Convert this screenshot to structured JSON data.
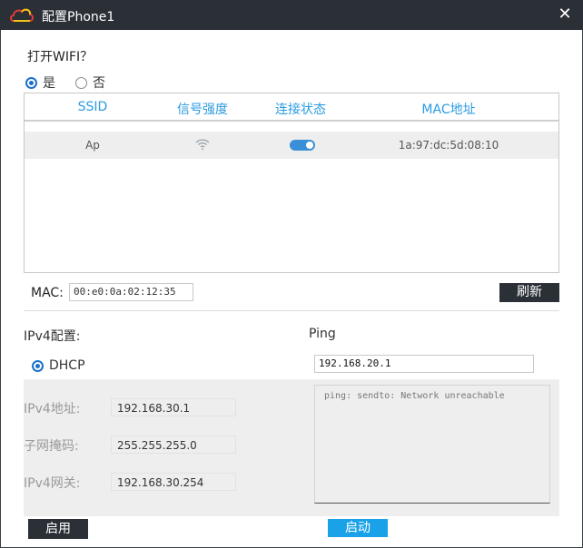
{
  "window": {
    "title": "配置Phone1",
    "close_glyph": "✕"
  },
  "wifi": {
    "question": "打开WIFI？",
    "options": [
      {
        "label": "是",
        "selected": true
      },
      {
        "label": "否",
        "selected": false
      }
    ],
    "table": {
      "headers": [
        "SSID",
        "信号强度",
        "连接状态",
        "MAC地址"
      ],
      "rows": [
        {
          "ssid": "Ap",
          "signal_icon": "wifi-signal-icon",
          "status_icon": "toggle-on-icon",
          "mac": "1a:97:dc:5d:08:10"
        }
      ]
    }
  },
  "mac": {
    "label": "MAC:",
    "value": "00:e0:0a:02:12:35",
    "refresh_label": "刷新"
  },
  "ipv4": {
    "title": "IPv4配置:",
    "mode_label": "DHCP",
    "fields": [
      {
        "label": "IPv4地址:",
        "value": "192.168.30.1"
      },
      {
        "label": "子网掩码:",
        "value": "255.255.255.0"
      },
      {
        "label": "IPv4网关:",
        "value": "192.168.30.254"
      }
    ],
    "enable_label": "启用"
  },
  "ping": {
    "title": "Ping",
    "target": "192.168.20.1",
    "output": "ping: sendto: Network unreachable",
    "start_label": "启动"
  },
  "colors": {
    "titlebar": "#2b2f36",
    "accent": "#2a9be0",
    "start_button": "#1aa2e8",
    "panel": "#eeeeee"
  }
}
